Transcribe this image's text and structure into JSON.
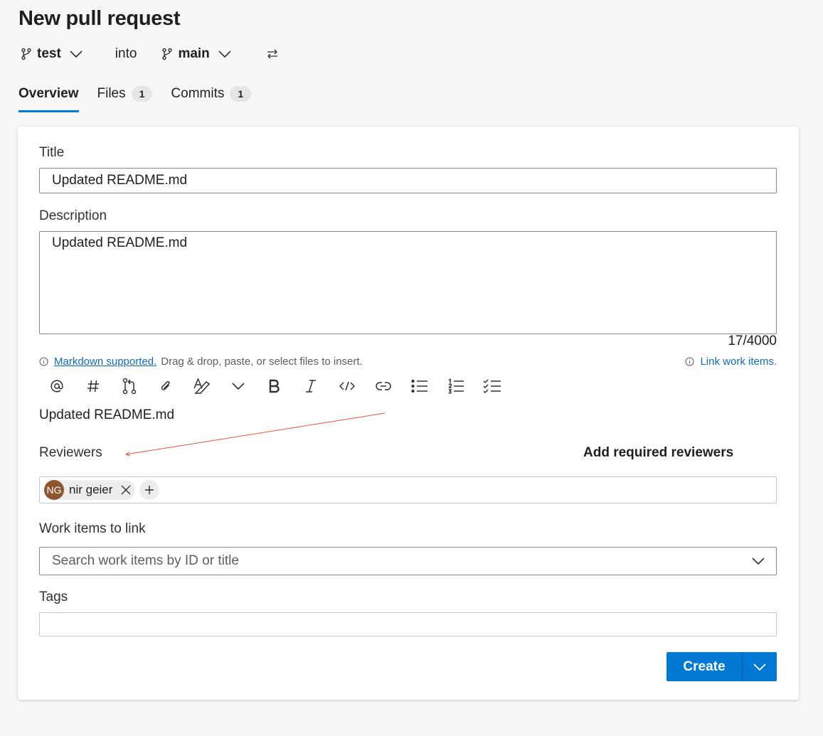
{
  "page": {
    "title": "New pull request"
  },
  "branches": {
    "source": "test",
    "connector": "into",
    "target": "main"
  },
  "tabs": [
    {
      "label": "Overview",
      "count": null
    },
    {
      "label": "Files",
      "count": "1"
    },
    {
      "label": "Commits",
      "count": "1"
    }
  ],
  "form": {
    "title_label": "Title",
    "title_value": "Updated README.md",
    "description_label": "Description",
    "description_value": "Updated README.md",
    "char_counter": "17/4000",
    "markdown_link": "Markdown supported.",
    "markdown_hint": "Drag & drop, paste, or select files to insert.",
    "link_work_items": "Link work items.",
    "preview_text": "Updated README.md",
    "reviewers_label": "Reviewers",
    "add_required_reviewers": "Add required reviewers",
    "reviewers": [
      {
        "initials": "NG",
        "name": "nir geier",
        "avatar_color": "#8e562e"
      }
    ],
    "work_items_label": "Work items to link",
    "work_items_placeholder": "Search work items by ID or title",
    "tags_label": "Tags",
    "create_label": "Create"
  },
  "toolbar_icons": [
    "mention-icon",
    "hashtag-icon",
    "pull-request-icon",
    "attach-icon",
    "format-text-icon",
    "chevron-down-icon",
    "bold-icon",
    "italic-icon",
    "code-icon",
    "link-icon",
    "bulleted-list-icon",
    "numbered-list-icon",
    "checklist-icon"
  ],
  "colors": {
    "accent": "#0078d4",
    "link": "#0f6cbd",
    "annotation": "#e8513a"
  }
}
